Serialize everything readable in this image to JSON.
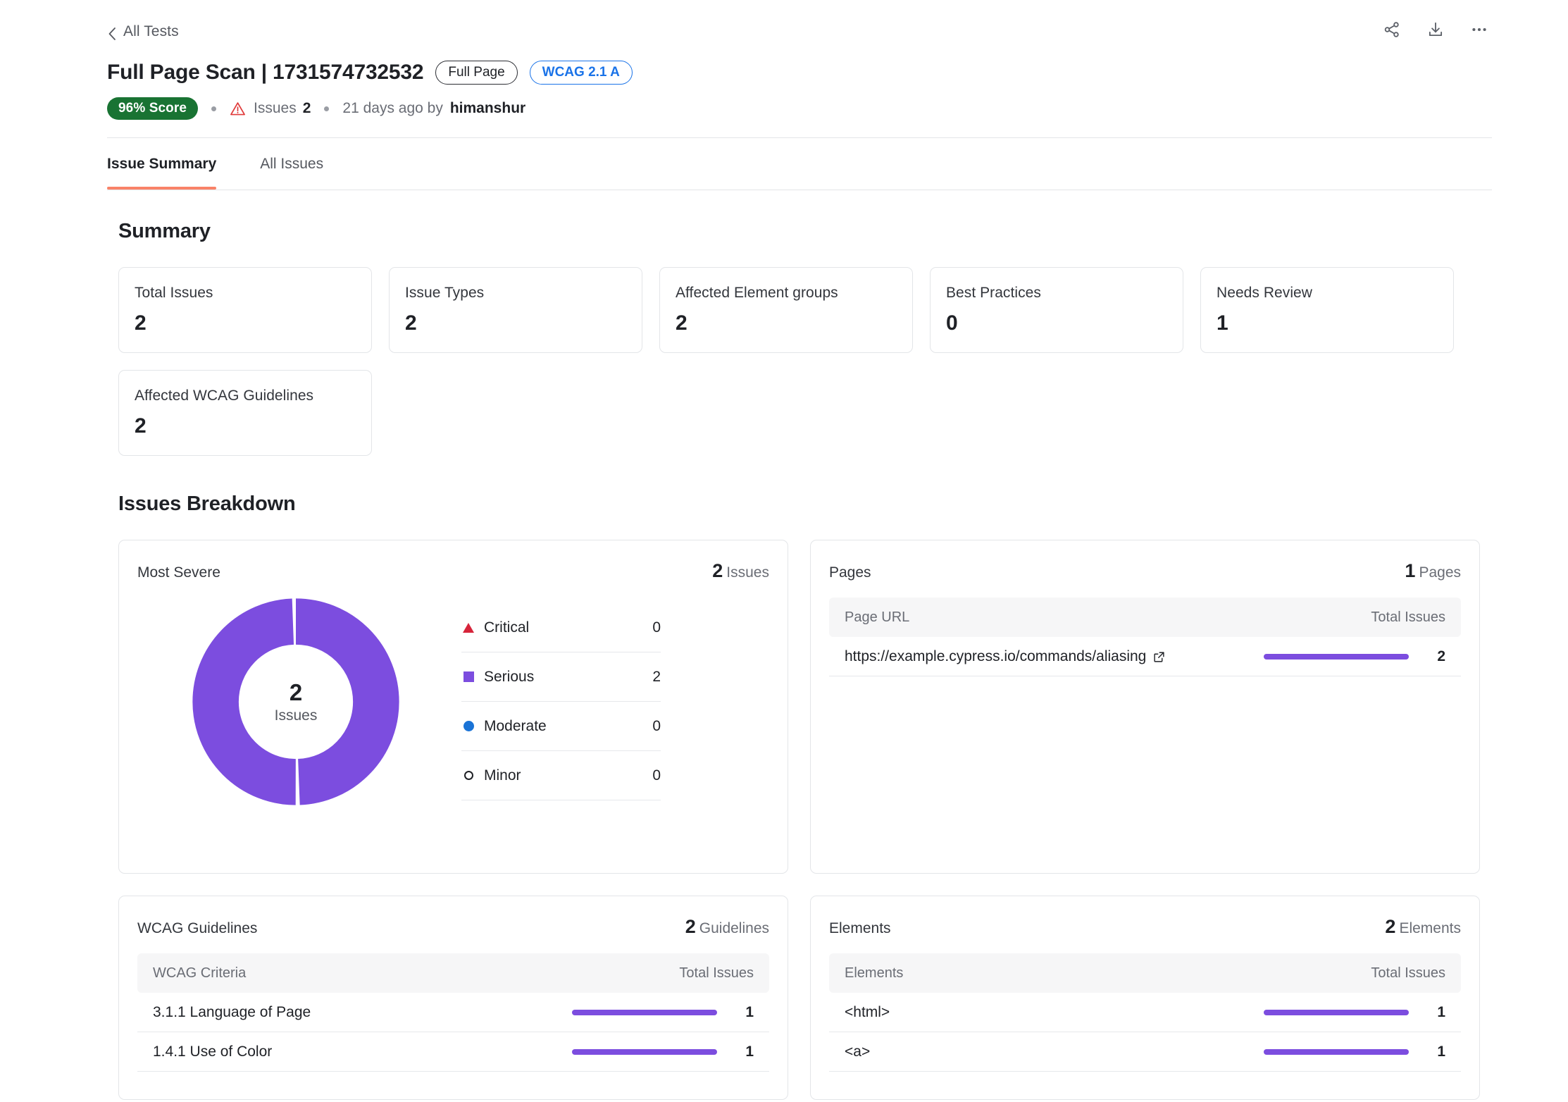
{
  "header": {
    "back_label": "All Tests",
    "title": "Full Page Scan | 1731574732532",
    "pill_full_page": "Full Page",
    "pill_wcag": "WCAG 2.1 A",
    "score_badge": "96% Score",
    "issues_label": "Issues",
    "issues_count": "2",
    "timestamp": "21 days ago by",
    "user": "himanshur",
    "actions": [
      "share-icon",
      "download-icon",
      "more-icon"
    ]
  },
  "tabs": [
    {
      "label": "Issue Summary",
      "active": true
    },
    {
      "label": "All Issues",
      "active": false
    }
  ],
  "summary": {
    "title": "Summary",
    "cards": [
      {
        "label": "Total Issues",
        "value": "2"
      },
      {
        "label": "Issue Types",
        "value": "2"
      },
      {
        "label": "Affected Element groups",
        "value": "2"
      },
      {
        "label": "Best Practices",
        "value": "0"
      },
      {
        "label": "Needs Review",
        "value": "1"
      },
      {
        "label": "Affected WCAG Guidelines",
        "value": "2"
      }
    ]
  },
  "breakdown": {
    "title": "Issues Breakdown",
    "most_severe": {
      "title": "Most Severe",
      "count": "2",
      "count_unit": "Issues",
      "center_value": "2",
      "center_label": "Issues",
      "legend": [
        {
          "label": "Critical",
          "value": "0",
          "marker": "triangle",
          "color": "#d6243a"
        },
        {
          "label": "Serious",
          "value": "2",
          "marker": "square",
          "color": "#7c4ddf"
        },
        {
          "label": "Moderate",
          "value": "0",
          "marker": "circle",
          "color": "#1a73d6"
        },
        {
          "label": "Minor",
          "value": "0",
          "marker": "ring",
          "color": "#1f2126"
        }
      ]
    },
    "pages": {
      "title": "Pages",
      "count": "1",
      "count_unit": "Pages",
      "col_name": "Page URL",
      "col_total": "Total Issues",
      "rows": [
        {
          "name": "https://example.cypress.io/commands/aliasing",
          "value": "2",
          "bar_pct": 100,
          "link": true
        }
      ]
    },
    "guidelines": {
      "title": "WCAG Guidelines",
      "count": "2",
      "count_unit": "Guidelines",
      "col_name": "WCAG Criteria",
      "col_total": "Total Issues",
      "rows": [
        {
          "name": "3.1.1 Language of Page",
          "value": "1",
          "bar_pct": 100
        },
        {
          "name": "1.4.1 Use of Color",
          "value": "1",
          "bar_pct": 100
        }
      ]
    },
    "elements": {
      "title": "Elements",
      "count": "2",
      "count_unit": "Elements",
      "col_name": "Elements",
      "col_total": "Total Issues",
      "rows": [
        {
          "name": "<html>",
          "value": "1",
          "bar_pct": 100
        },
        {
          "name": "<a>",
          "value": "1",
          "bar_pct": 100
        }
      ]
    }
  },
  "chart_data": {
    "type": "pie",
    "title": "Most Severe",
    "categories": [
      "Critical",
      "Serious",
      "Moderate",
      "Minor"
    ],
    "values": [
      0,
      2,
      0,
      0
    ],
    "colors": [
      "#d6243a",
      "#7c4ddf",
      "#1a73d6",
      "#1f2126"
    ],
    "total": 2,
    "center_label": "Issues",
    "legend_position": "right",
    "donut": true,
    "segments": [
      {
        "name": "Serious",
        "value": 1,
        "color": "#7c4ddf"
      },
      {
        "name": "Serious",
        "value": 1,
        "color": "#7c4ddf"
      }
    ]
  },
  "colors": {
    "accent_purple": "#7c4ddf",
    "tab_active": "#f98268",
    "score_green": "#197333",
    "link_blue": "#1a73e8",
    "critical_red": "#d6243a"
  }
}
